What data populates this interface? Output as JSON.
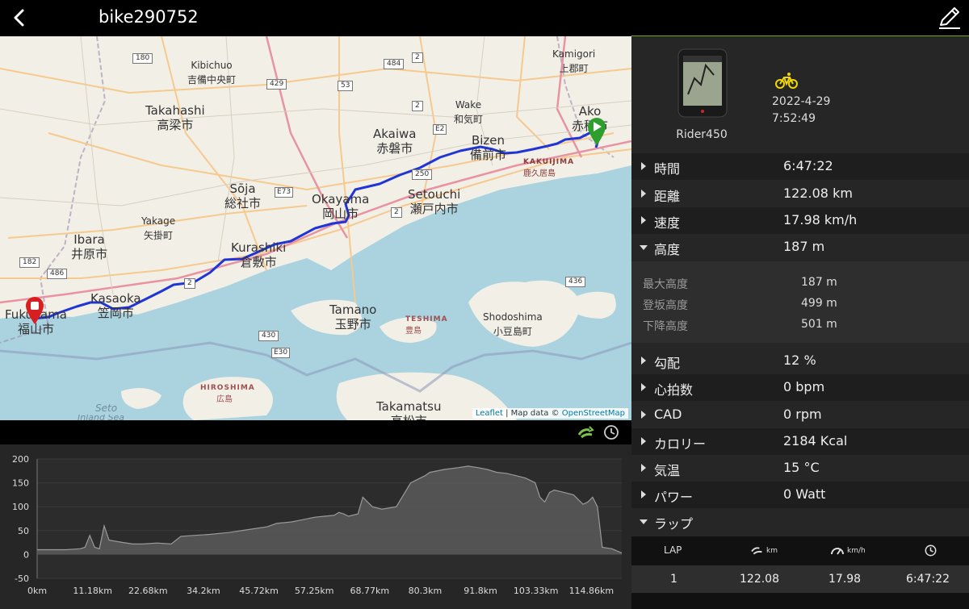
{
  "header": {
    "title": "bike290752"
  },
  "map": {
    "attribution_leaflet": "Leaflet",
    "attribution_sep": " | Map data © ",
    "attribution_osm": "OpenStreetMap",
    "places": {
      "kibichuo": {
        "en": "Kibichuo",
        "jp": "吉備中央町"
      },
      "kamigori": {
        "en": "Kamigori",
        "jp": "上郡町"
      },
      "takahashi": {
        "en": "Takahashi",
        "jp": "高梁市"
      },
      "wake": {
        "en": "Wake",
        "jp": "和気町"
      },
      "ako": {
        "en": "Ako",
        "jp": "赤穂市"
      },
      "akaiwa": {
        "en": "Akaiwa",
        "jp": "赤磐市"
      },
      "bizen": {
        "en": "Bizen",
        "jp": "備前市"
      },
      "kakuijima": {
        "en": "KAKUIJIMA",
        "jp": "鹿久居島"
      },
      "soja": {
        "en": "Sōja",
        "jp": "総社市"
      },
      "okayama": {
        "en": "Okayama",
        "jp": "岡山市"
      },
      "setouchi": {
        "en": "Setouchi",
        "jp": "瀬戸内市"
      },
      "yakage": {
        "en": "Yakage",
        "jp": "矢掛町"
      },
      "ibara": {
        "en": "Ibara",
        "jp": "井原市"
      },
      "kurashiki": {
        "en": "Kurashiki",
        "jp": "倉敷市"
      },
      "kasaoka": {
        "en": "Kasaoka",
        "jp": "笠岡市"
      },
      "fukuyama": {
        "en": "Fukuyama",
        "jp": "福山市"
      },
      "tamano": {
        "en": "Tamano",
        "jp": "玉野市"
      },
      "teshima": {
        "en": "TESHIMA",
        "jp": "豊島"
      },
      "shodoshima": {
        "en": "Shodoshima",
        "jp": "小豆島町"
      },
      "hiroshima": {
        "en": "HIROSHIMA",
        "jp": "広島"
      },
      "takamatsu": {
        "en": "Takamatsu",
        "jp": "高松市"
      },
      "seto": {
        "en": "Seto"
      },
      "inland": {
        "en": "Inland Sea"
      }
    },
    "shields": [
      "180",
      "429",
      "53",
      "484",
      "2",
      "E2",
      "E73",
      "250",
      "2",
      "436",
      "430",
      "E30",
      "182",
      "486",
      "2",
      "2"
    ]
  },
  "device": {
    "name": "Rider450",
    "date": "2022-4-29",
    "time": "7:52:49"
  },
  "stats": [
    {
      "key": "時間",
      "value": "6:47:22"
    },
    {
      "key": "距離",
      "value": "122.08 km"
    },
    {
      "key": "速度",
      "value": "17.98 km/h"
    },
    {
      "key": "高度",
      "value": "187 m"
    },
    {
      "key": "勾配",
      "value": "12 %"
    },
    {
      "key": "心拍数",
      "value": "0 bpm"
    },
    {
      "key": "CAD",
      "value": "0 rpm"
    },
    {
      "key": "カロリー",
      "value": "2184 Kcal"
    },
    {
      "key": "気温",
      "value": "15 °C"
    },
    {
      "key": "パワー",
      "value": "0 Watt"
    },
    {
      "key": "ラップ",
      "value": ""
    }
  ],
  "altitude_detail": [
    {
      "key": "最大高度",
      "value": "187 m"
    },
    {
      "key": "登坂高度",
      "value": "499 m"
    },
    {
      "key": "下降高度",
      "value": "501 m"
    }
  ],
  "laps": {
    "header": {
      "lap": "LAP",
      "km": "km",
      "kmh": "km/h"
    },
    "rows": [
      {
        "lap": "1",
        "distance": "122.08",
        "speed": "17.98",
        "time": "6:47:22"
      }
    ]
  },
  "colors": {
    "route": "#1f35d6",
    "accent_green": "#6fa63a",
    "bike_yellow": "#f2d800",
    "start_marker": "#2e9e2e",
    "end_marker": "#d81f1f"
  },
  "chart_data": {
    "type": "area",
    "ylim": [
      -50,
      200
    ],
    "yticks": [
      "200",
      "150",
      "100",
      "50",
      "0",
      "-50"
    ],
    "xticks": [
      "0km",
      "11.18km",
      "22.68km",
      "34.2km",
      "45.72km",
      "57.25km",
      "68.77km",
      "80.3km",
      "91.8km",
      "103.33km",
      "114.86km"
    ],
    "x": [
      0,
      3,
      6,
      9,
      10,
      11,
      12,
      13,
      14,
      15,
      18,
      20,
      22,
      25,
      28,
      30,
      33,
      36,
      40,
      44,
      48,
      50,
      53,
      55,
      58,
      60,
      62,
      63,
      64,
      65,
      67,
      68,
      70,
      72,
      75,
      78,
      80,
      81,
      82,
      85,
      88,
      90,
      92,
      94,
      96,
      98,
      100,
      102,
      104,
      105,
      106,
      107,
      108,
      110,
      112,
      114,
      115,
      116,
      117,
      118,
      120,
      122.08
    ],
    "y": [
      10,
      10,
      10,
      12,
      15,
      40,
      15,
      12,
      60,
      30,
      25,
      22,
      22,
      24,
      22,
      38,
      40,
      42,
      46,
      52,
      58,
      65,
      68,
      72,
      78,
      80,
      82,
      88,
      85,
      80,
      85,
      120,
      100,
      95,
      100,
      150,
      160,
      165,
      172,
      178,
      182,
      185,
      182,
      178,
      172,
      170,
      165,
      160,
      150,
      120,
      110,
      130,
      135,
      130,
      125,
      105,
      110,
      120,
      100,
      15,
      12,
      3
    ]
  }
}
